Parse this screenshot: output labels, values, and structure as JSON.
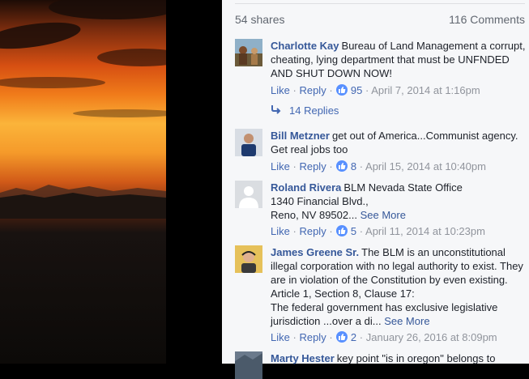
{
  "post": {
    "shares": "54 shares",
    "comments_count": "116 Comments"
  },
  "actions": {
    "like": "Like",
    "reply": "Reply",
    "sep": "·"
  },
  "comments": [
    {
      "author": "Charlotte Kay",
      "text": "Bureau of Land Management a corrupt, cheating, lying department that must be UNFNDED AND SHUT DOWN NOW!",
      "likes": "95",
      "date": "April 7, 2014 at 1:16pm",
      "replies": "14 Replies",
      "avatar_color": "#8a6a3a"
    },
    {
      "author": "Bill Metzner",
      "text": "get out of America...Communist agency. Get real jobs too",
      "likes": "8",
      "date": "April 15, 2014 at 10:40pm",
      "avatar_color": "#2d4a7a"
    },
    {
      "author": "Roland Rivera",
      "line1": "BLM Nevada State Office",
      "line2": "1340 Financial Blvd.,",
      "line3": "Reno, NV 89502...",
      "see_more": "See More",
      "likes": "5",
      "date": "April 11, 2014 at 10:23pm",
      "avatar_color": "#d7d9dd"
    },
    {
      "author": "James Greene Sr.",
      "text": "The BLM is an unconstitutional illegal corporation with no legal authority to exist. They are in violation of the Constitution by even existing. Article 1, Section 8, Clause 17:",
      "text2": "The federal government has exclusive legislative jurisdiction ...over a di...",
      "see_more": "See More",
      "likes": "2",
      "date": "January 26, 2016 at 8:09pm",
      "avatar_color": "#c9a23a"
    },
    {
      "author": "Marty Hester",
      "text": "key point \"is in oregon\" belongs to",
      "avatar_color": "#6b7a8c"
    }
  ]
}
